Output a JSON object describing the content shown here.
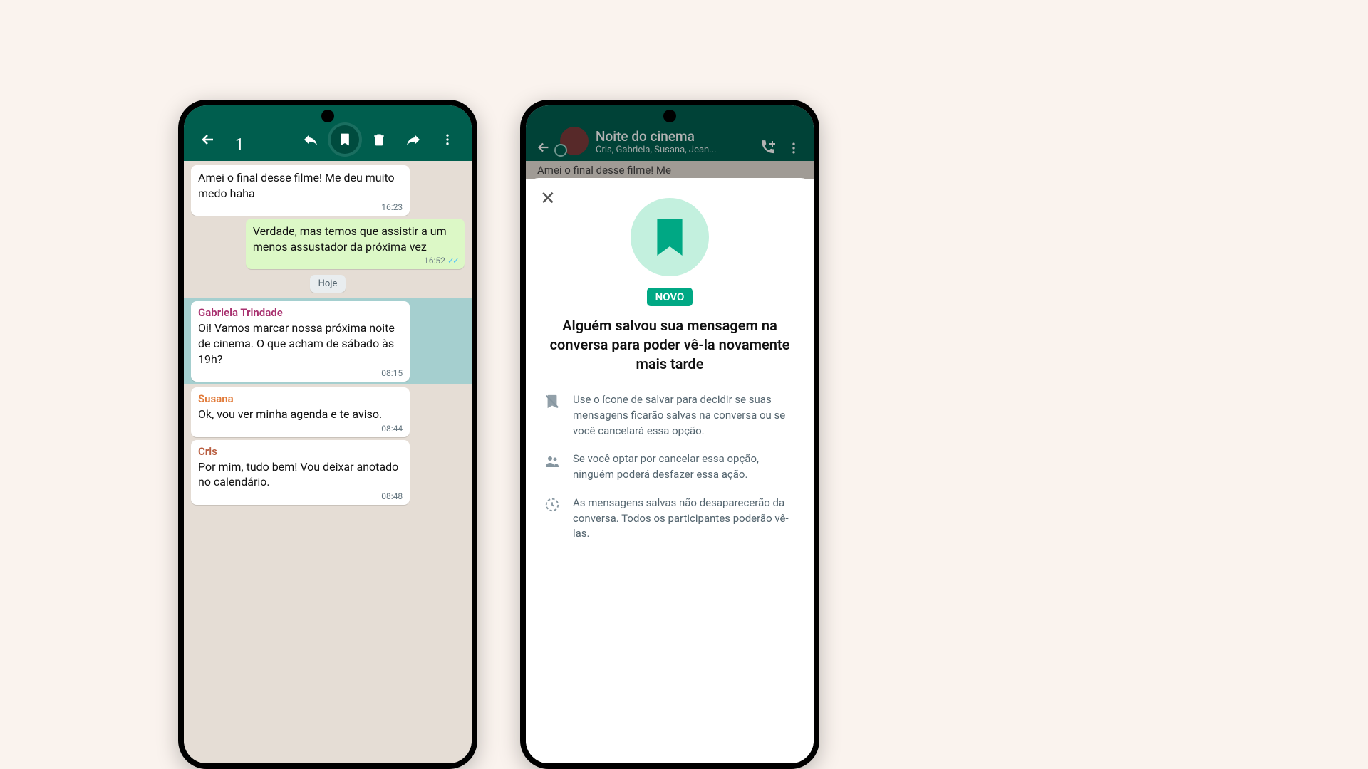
{
  "phone1": {
    "header": {
      "selected_count": "1"
    },
    "messages": {
      "m0": {
        "text": "Amei o final desse filme! Me deu muito medo haha",
        "time": "16:23"
      },
      "m1": {
        "text": "Verdade, mas temos que assistir a um menos assustador da próxima vez",
        "time": "16:52"
      },
      "date_label": "Hoje",
      "m2": {
        "sender": "Gabriela Trindade",
        "text": "Oi! Vamos marcar nossa próxima noite de cinema. O que acham de sábado às 19h?",
        "time": "08:15"
      },
      "m3": {
        "sender": "Susana",
        "text": "Ok, vou ver minha agenda e te aviso.",
        "time": "08:44"
      },
      "m4": {
        "sender": "Cris",
        "text": "Por mim, tudo bem! Vou deixar anotado no calendário.",
        "time": "08:48"
      }
    },
    "sender_colors": {
      "gabriela": "#a8316f",
      "susana": "#e17b3a",
      "cris": "#b85c3e"
    }
  },
  "phone2": {
    "header": {
      "title": "Noite do cinema",
      "subtitle": "Cris, Gabriela, Susana, Jean..."
    },
    "peek": "Amei o final desse filme! Me",
    "sheet": {
      "badge": "NOVO",
      "heading": "Alguém salvou sua mensagem na conversa para poder vê-la novamente mais tarde",
      "rows": {
        "r1": "Use o ícone de salvar para decidir se suas mensagens ficarão salvas na conversa ou se você cancelará essa opção.",
        "r2": "Se você optar por cancelar essa opção, ninguém poderá desfazer essa ação.",
        "r3": "As mensagens salvas não desaparecerão da conversa. Todos os participantes poderão vê-las."
      }
    }
  }
}
